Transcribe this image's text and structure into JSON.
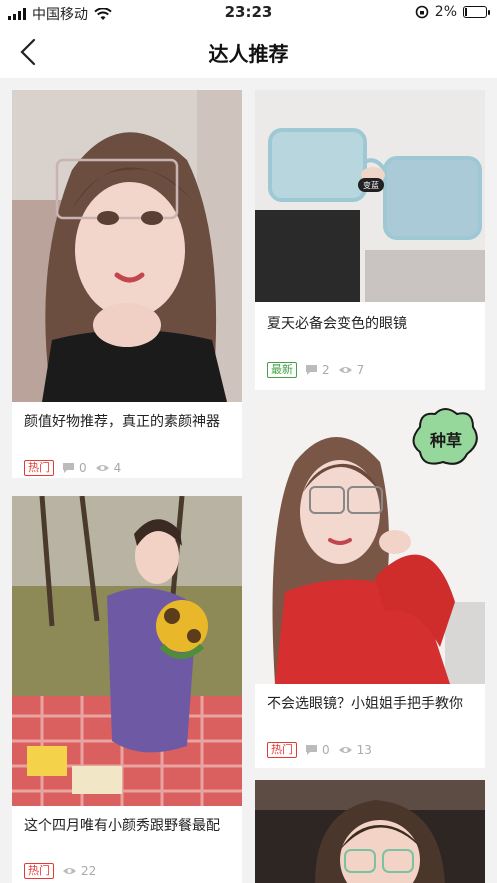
{
  "status_bar": {
    "carrier": "中国移动",
    "time": "23:23",
    "battery": "2%"
  },
  "nav": {
    "title": "达人推荐"
  },
  "cards": [
    {
      "caption": "颜值好物推荐，真正的素颜神器",
      "tag": "热门",
      "comments": "0",
      "views": "4"
    },
    {
      "caption": "夏天必备会变色的眼镜",
      "tag": "最新",
      "comments": "2",
      "views": "7",
      "photo_badge": "变蓝"
    },
    {
      "caption": "这个四月唯有小颜秀跟野餐最配",
      "tag": "热门",
      "comments": "",
      "views": "22"
    },
    {
      "caption": "不会选眼镜？小姐姐手把手教你",
      "tag": "热门",
      "comments": "0",
      "views": "13",
      "photo_sticker": "种草"
    },
    {
      "caption": "",
      "tag": "",
      "comments": "",
      "views": ""
    }
  ]
}
